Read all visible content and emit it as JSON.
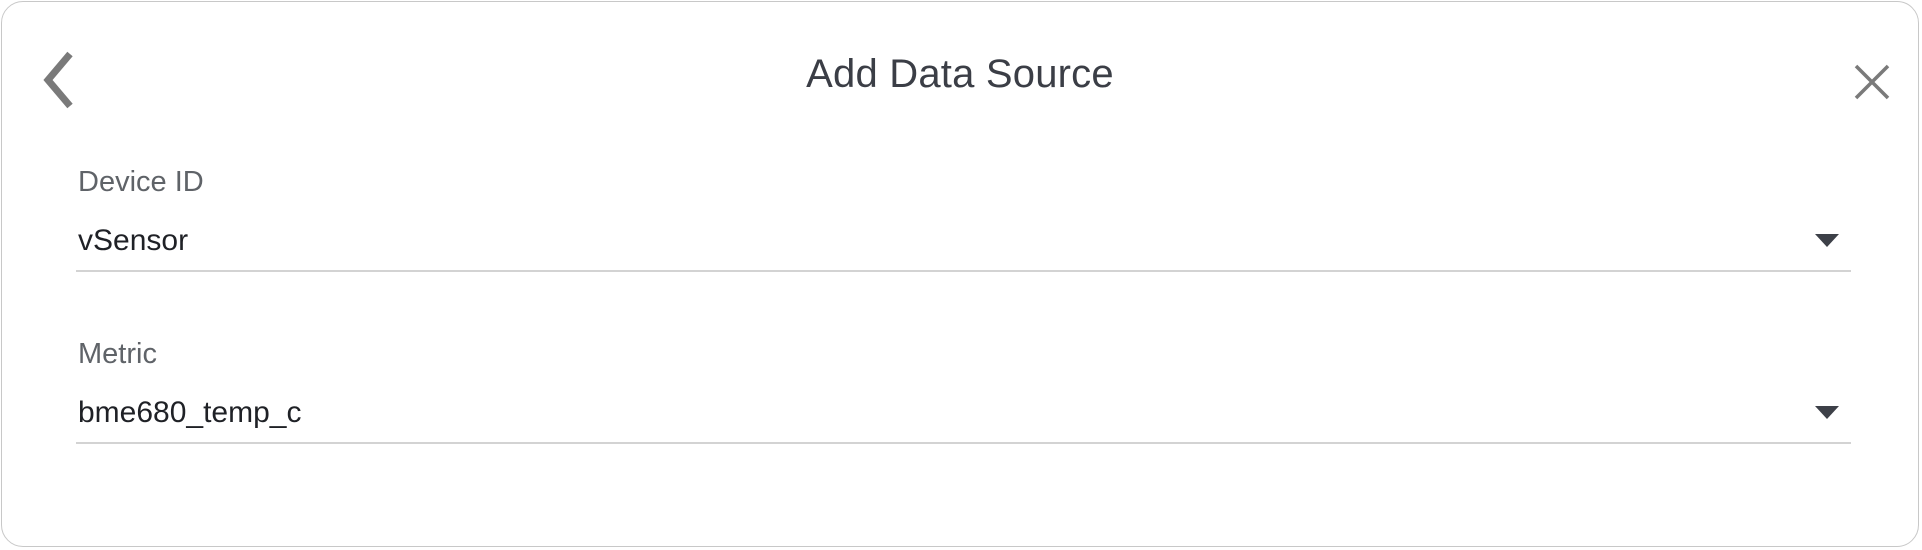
{
  "dialog": {
    "title": "Add Data Source",
    "back_icon": "chevron-left-icon",
    "close_icon": "close-icon"
  },
  "fields": [
    {
      "label": "Device ID",
      "value": "vSensor",
      "icon": "dropdown-arrow-icon"
    },
    {
      "label": "Metric",
      "value": "bme680_temp_c",
      "icon": "dropdown-arrow-icon"
    }
  ],
  "colors": {
    "text": "#3b3e46",
    "label": "#5f6368",
    "icon": "#7a7a7a",
    "underline": "#d3d3d3",
    "border": "#c8c8c8"
  }
}
